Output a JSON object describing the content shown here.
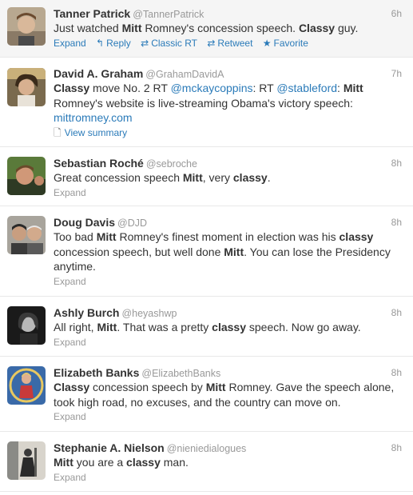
{
  "tweets": [
    {
      "name": "Tanner Patrick",
      "handle": "@TannerPatrick",
      "time": "6h",
      "lines": [
        [
          {
            "t": "Just watched "
          },
          {
            "b": "Mitt"
          },
          {
            "t": " Romney's concession speech. "
          },
          {
            "b": "Classy"
          },
          {
            "t": " guy."
          }
        ]
      ],
      "actions": {
        "expand": "Expand",
        "reply": "Reply",
        "classic_rt": "Classic RT",
        "retweet": "Retweet",
        "favorite": "Favorite",
        "reply_icon": "reply-arrow-icon",
        "classic_rt_icon": "retweet-icon",
        "retweet_icon": "retweet-icon",
        "favorite_icon": "star-icon"
      }
    },
    {
      "name": "David A. Graham",
      "handle": "@GrahamDavidA",
      "time": "7h",
      "lines": [
        [
          {
            "b": "Classy"
          },
          {
            "t": " move No. 2 RT "
          },
          {
            "l": "@mckaycoppins"
          },
          {
            "t": ": RT "
          },
          {
            "l": "@stableford"
          },
          {
            "t": ": "
          },
          {
            "b": "Mitt"
          }
        ],
        [
          {
            "t": "Romney's website is live-streaming Obama's victory speech:"
          }
        ],
        [
          {
            "l": "mittromney.com"
          }
        ]
      ],
      "summary": "View summary",
      "summary_icon": "document-icon"
    },
    {
      "name": "Sebastian Roché",
      "handle": "@sebroche",
      "time": "8h",
      "lines": [
        [
          {
            "t": "Great concession speech "
          },
          {
            "b": "Mitt"
          },
          {
            "t": ", very "
          },
          {
            "b": "classy"
          },
          {
            "t": "."
          }
        ]
      ],
      "expand": "Expand"
    },
    {
      "name": "Doug Davis",
      "handle": "@DJD",
      "time": "8h",
      "lines": [
        [
          {
            "t": "Too bad "
          },
          {
            "b": "Mitt"
          },
          {
            "t": " Romney's finest moment in election was his "
          },
          {
            "b": "classy"
          }
        ],
        [
          {
            "t": "concession speech, but well done "
          },
          {
            "b": "Mitt"
          },
          {
            "t": ". You can lose the Presidency"
          }
        ],
        [
          {
            "t": "anytime."
          }
        ]
      ],
      "expand": "Expand"
    },
    {
      "name": "Ashly Burch",
      "handle": "@heyashwp",
      "time": "8h",
      "lines": [
        [
          {
            "t": "All right, "
          },
          {
            "b": "Mitt"
          },
          {
            "t": ". That was a pretty "
          },
          {
            "b": "classy"
          },
          {
            "t": " speech. Now go away."
          }
        ]
      ],
      "expand": "Expand"
    },
    {
      "name": "Elizabeth Banks",
      "handle": "@ElizabethBanks",
      "time": "8h",
      "lines": [
        [
          {
            "b": "Classy"
          },
          {
            "t": " concession speech by "
          },
          {
            "b": "Mitt"
          },
          {
            "t": " Romney. Gave the speech alone,"
          }
        ],
        [
          {
            "t": "took high road, no excuses, and the country can move on."
          }
        ]
      ],
      "expand": "Expand"
    },
    {
      "name": "Stephanie A. Nielson",
      "handle": "@nieniedialogues",
      "time": "8h",
      "lines": [
        [
          {
            "b": "Mitt"
          },
          {
            "t": " you are a "
          },
          {
            "b": "classy"
          },
          {
            "t": " man."
          }
        ]
      ],
      "expand": "Expand"
    }
  ],
  "colors": {
    "link": "#2b7bb9",
    "muted": "#999999",
    "text": "#333333",
    "highlight_bg": "#f5f5f5"
  }
}
